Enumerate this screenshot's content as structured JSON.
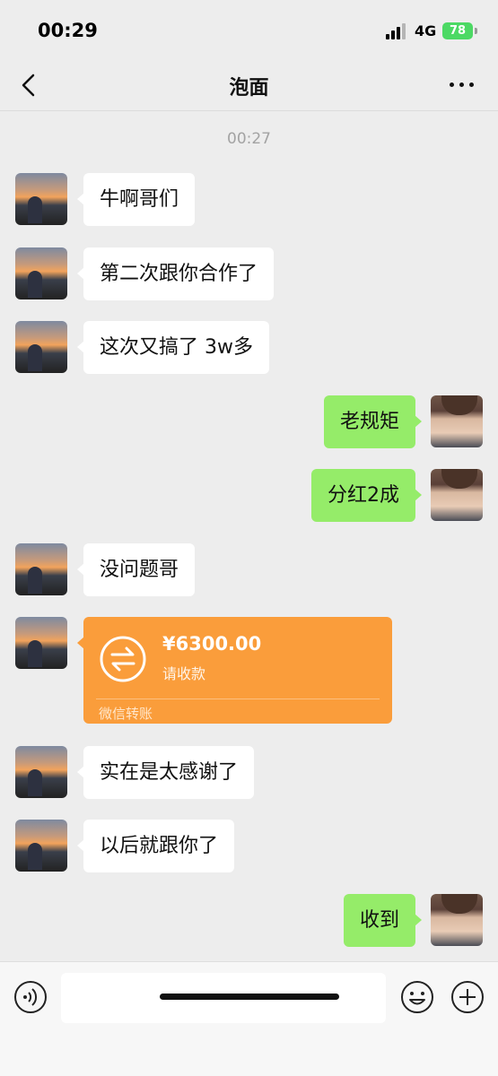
{
  "status_bar": {
    "time": "00:29",
    "network": "4G",
    "battery": "78"
  },
  "header": {
    "title": "泡面"
  },
  "timestamp": "00:27",
  "messages": [
    {
      "side": "in",
      "text": "牛啊哥们"
    },
    {
      "side": "in",
      "text": "第二次跟你合作了"
    },
    {
      "side": "in",
      "text": "这次又搞了 3w多"
    },
    {
      "side": "out",
      "text": "老规矩"
    },
    {
      "side": "out",
      "text": "分红2成"
    },
    {
      "side": "in",
      "text": "没问题哥"
    },
    {
      "side": "in",
      "text": "实在是太感谢了"
    },
    {
      "side": "in",
      "text": "以后就跟你了"
    },
    {
      "side": "out",
      "text": "收到"
    }
  ],
  "transfer": {
    "amount": "¥6300.00",
    "status": "请收款",
    "footer": "微信转账"
  },
  "colors": {
    "background": "#ededed",
    "outgoing_bubble": "#95ec69",
    "incoming_bubble": "#ffffff",
    "transfer_card": "#fa9d3b",
    "battery": "#4cd964"
  },
  "icons": [
    "back-icon",
    "more-icon",
    "voice-icon",
    "emoji-icon",
    "plus-icon",
    "transfer-icon"
  ]
}
